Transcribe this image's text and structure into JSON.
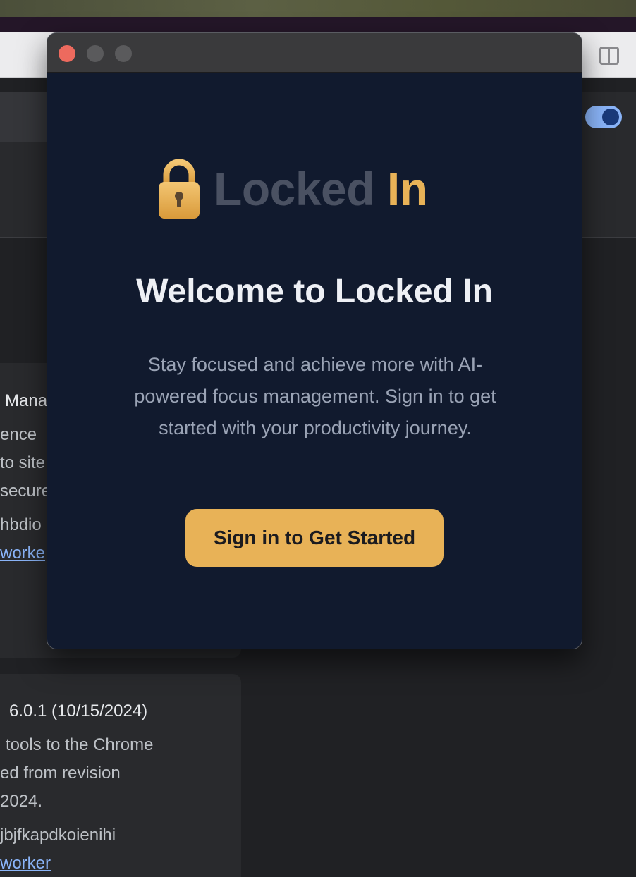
{
  "window": {
    "controls": [
      "close",
      "minimize",
      "maximize"
    ]
  },
  "popup": {
    "logo": {
      "icon": "padlock-icon",
      "word1": "Locked",
      "word2": "In",
      "word1_color": "#4a5162",
      "word2_color": "#e8b257"
    },
    "title": "Welcome to Locked In",
    "description": "Stay focused and achieve more with AI-powered focus management. Sign in to get started with your productivity journey.",
    "cta_label": "Sign in to Get Started",
    "colors": {
      "background": "#111a2e",
      "accent": "#e8b257"
    }
  },
  "background_page": {
    "card1": {
      "lines": [
        "Mana",
        "ence",
        "to site",
        "secure",
        "hbdio",
        "worke"
      ]
    },
    "card2": {
      "lines": [
        "6.0.1 (10/15/2024)",
        "tools to the Chrome",
        "ed from revision",
        "2024.",
        "jbjfkapdkoienihi",
        "worker"
      ]
    }
  }
}
